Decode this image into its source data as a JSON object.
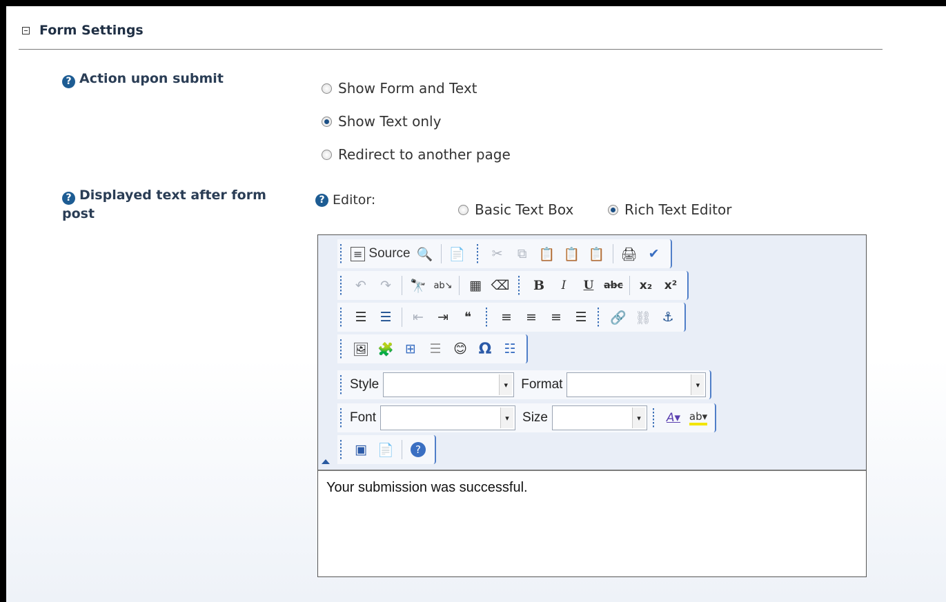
{
  "section": {
    "title": "Form Settings"
  },
  "action_upon_submit": {
    "label": "Action upon submit",
    "options": [
      {
        "label": "Show Form and Text",
        "checked": false
      },
      {
        "label": "Show Text only",
        "checked": true
      },
      {
        "label": "Redirect to another page",
        "checked": false
      }
    ]
  },
  "displayed_text": {
    "label": "Displayed text after form post",
    "editor_label": "Editor:",
    "editor_options": [
      {
        "label": "Basic Text Box",
        "checked": false
      },
      {
        "label": "Rich Text Editor",
        "checked": true
      }
    ]
  },
  "rich_editor": {
    "source_label": "Source",
    "style_label": "Style",
    "format_label": "Format",
    "font_label": "Font",
    "size_label": "Size",
    "content": "Your submission was successful."
  },
  "icons": {
    "help": "?",
    "bold": "B",
    "italic": "I",
    "underline": "U",
    "strike": "abc",
    "subscript": "x₂",
    "superscript": "x²",
    "omega": "Ω",
    "quote": "❝",
    "dropdown": "▾"
  },
  "colors": {
    "header_text": "#1f2f44",
    "help_icon": "#1d5c93",
    "toolbar_bg": "#e9eef7",
    "toolbar_accent": "#4f7ec8"
  }
}
